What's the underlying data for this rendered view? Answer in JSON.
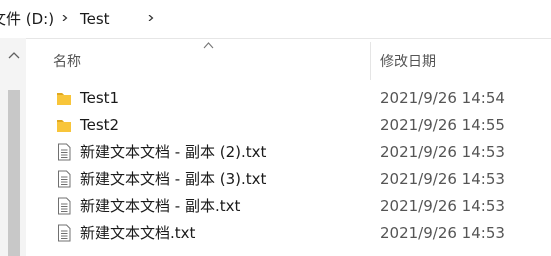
{
  "breadcrumb": {
    "drive": "文件 (D:)",
    "folder": "Test"
  },
  "columns": {
    "name": "名称",
    "date_modified": "修改日期"
  },
  "files": [
    {
      "name": "Test1",
      "date": "2021/9/26 14:54",
      "kind": "folder-icon"
    },
    {
      "name": "Test2",
      "date": "2021/9/26 14:55",
      "kind": "folder-icon"
    },
    {
      "name": "新建文本文档 - 副本 (2).txt",
      "date": "2021/9/26 14:53",
      "kind": "text-file-icon"
    },
    {
      "name": "新建文本文档 - 副本 (3).txt",
      "date": "2021/9/26 14:53",
      "kind": "text-file-icon"
    },
    {
      "name": "新建文本文档 - 副本.txt",
      "date": "2021/9/26 14:53",
      "kind": "text-file-icon"
    },
    {
      "name": "新建文本文档.txt",
      "date": "2021/9/26 14:53",
      "kind": "text-file-icon"
    }
  ],
  "colors": {
    "folder": "#f8c53a",
    "text": "#1a1a1a",
    "secondary_text": "#555555"
  }
}
